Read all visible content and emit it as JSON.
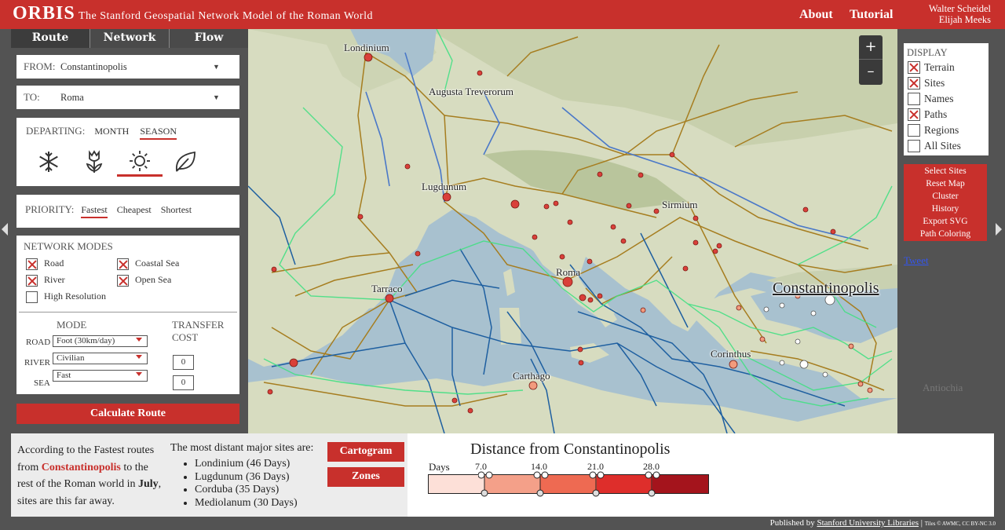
{
  "header": {
    "logo": "ORBIS",
    "subtitle": "The Stanford Geospatial Network Model of the Roman World",
    "nav_about": "About",
    "nav_tutorial": "Tutorial",
    "author1": "Walter Scheidel",
    "author2": "Elijah Meeks"
  },
  "tabs": [
    "Route",
    "Network",
    "Flow"
  ],
  "route": {
    "from_label": "FROM:",
    "from_value": "Constantinopolis",
    "to_label": "TO:",
    "to_value": "Roma",
    "departing_label": "DEPARTING:",
    "month_label": "MONTH",
    "season_label": "SEASON",
    "season_icons": [
      "snowflake-icon",
      "tulip-icon",
      "sun-icon",
      "leaf-icon"
    ],
    "priority_label": "PRIORITY:",
    "priority_options": [
      "Fastest",
      "Cheapest",
      "Shortest"
    ],
    "network_modes_label": "NETWORK MODES",
    "modes": [
      {
        "label": "Road",
        "checked": true
      },
      {
        "label": "Coastal Sea",
        "checked": true
      },
      {
        "label": "River",
        "checked": true
      },
      {
        "label": "Open Sea",
        "checked": true
      },
      {
        "label": "High Resolution",
        "checked": false
      }
    ],
    "mode_header": "MODE",
    "transfer_header_1": "TRANSFER",
    "transfer_header_2": "COST",
    "road_label": "ROAD",
    "road_value": "Foot (30km/day)",
    "river_label": "RIVER",
    "river_value": "Civilian",
    "sea_label": "SEA",
    "sea_value": "Fast",
    "transfer_river": "0",
    "transfer_sea": "0",
    "calculate_label": "Calculate Route"
  },
  "display": {
    "title": "DISPLAY",
    "items": [
      {
        "label": "Terrain",
        "checked": true
      },
      {
        "label": "Sites",
        "checked": true
      },
      {
        "label": "Names",
        "checked": false
      },
      {
        "label": "Paths",
        "checked": true
      },
      {
        "label": "Regions",
        "checked": false
      },
      {
        "label": "All Sites",
        "checked": false
      }
    ]
  },
  "actions": [
    "Select Sites",
    "Reset Map",
    "Cluster",
    "History",
    "Export SVG",
    "Path Coloring"
  ],
  "tweet": "Tweet",
  "map": {
    "zoom_in": "+",
    "zoom_out": "–",
    "cities": [
      "Londinium",
      "Augusta Treverorum",
      "Lugdunum",
      "Sirmium",
      "Roma",
      "Tarraco",
      "Constantinopolis",
      "Corinthus",
      "Carthago",
      "Antiochia"
    ]
  },
  "summary": {
    "line1": "According to the Fastest routes",
    "line2_pre": "from ",
    "line2_city": "Constantinopolis",
    "line2_post": " to the",
    "line3_pre": "rest of the Roman world in ",
    "line3_month": "July",
    ", ": "",
    "line3_post": ",",
    "line4": "sites are this far away.",
    "distant_title": "The most distant major sites are:",
    "distant": [
      "Londinium (46 Days)",
      "Lugdunum (36 Days)",
      "Corduba (35 Days)",
      "Mediolanum (30 Days)"
    ],
    "cartogram": "Cartogram",
    "zones": "Zones"
  },
  "legend": {
    "title": "Distance from Constantinopolis",
    "days_label": "Days",
    "ticks": [
      "7.0",
      "14.0",
      "21.0",
      "28.0"
    ],
    "colors": [
      "#fde0d8",
      "#f4a089",
      "#ee6a52",
      "#de2e2b",
      "#a4141c"
    ]
  },
  "footer": {
    "published": "Published by ",
    "library": "Stanford University Libraries",
    "tiles": "Tiles © AWMC, CC BY-NC 3.0"
  }
}
